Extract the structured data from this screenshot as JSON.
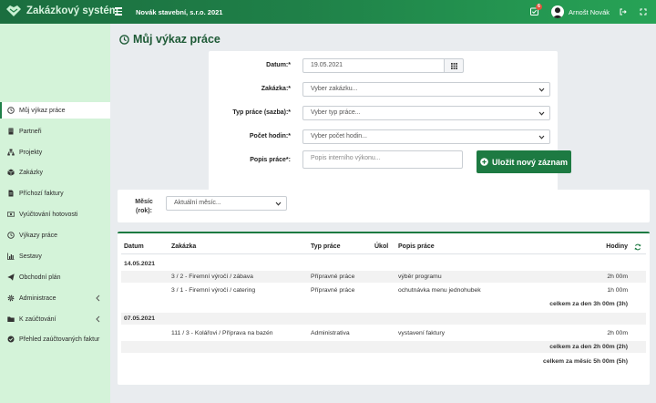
{
  "app": {
    "title": "Zakázkový systém",
    "company": "Novák stavební, s.r.o. 2021",
    "user": "Arnošt Novák",
    "task_badge": "6"
  },
  "sidebar": {
    "items": [
      {
        "label": "Můj výkaz práce",
        "icon": "clock-icon",
        "active": true
      },
      {
        "label": "Partneři",
        "icon": "building-icon"
      },
      {
        "label": "Projekty",
        "icon": "sitemap-icon"
      },
      {
        "label": "Zakázky",
        "icon": "box-icon"
      },
      {
        "label": "Příchozí faktury",
        "icon": "document-icon"
      },
      {
        "label": "Vyúčtování hotovosti",
        "icon": "money-icon"
      },
      {
        "label": "Výkazy práce",
        "icon": "clock-icon"
      },
      {
        "label": "Sestavy",
        "icon": "bar-chart-icon"
      },
      {
        "label": "Obchodní plán",
        "icon": "paper-plane-icon"
      },
      {
        "label": "Administrace",
        "icon": "gear-icon",
        "submenu": true
      },
      {
        "label": "K zaúčtování",
        "icon": "folder-icon",
        "submenu": true
      },
      {
        "label": "Přehled zaúčtovaných faktur",
        "icon": "check-circle-icon"
      }
    ]
  },
  "page": {
    "title": "Můj výkaz práce"
  },
  "form": {
    "date_label": "Datum:*",
    "date_value": "19.05.2021",
    "order_label": "Zakázka:*",
    "order_placeholder": "Vyber zakázku...",
    "worktype_label": "Typ práce (sazba):*",
    "worktype_placeholder": "Vyber typ práce...",
    "hours_label": "Počet hodin:*",
    "hours_placeholder": "Vyber počet hodin...",
    "desc_label": "Popis práce*:",
    "desc_placeholder": "Popis interního výkonu...",
    "save_label": "Uložit nový záznam"
  },
  "filter": {
    "month_label_line1": "Měsíc",
    "month_label_line2": "(rok):",
    "month_value": "Aktuální měsíc..."
  },
  "table": {
    "headers": {
      "date": "Datum",
      "order": "Zakázka",
      "type": "Typ práce",
      "task": "Úkol",
      "desc": "Popis práce",
      "hours": "Hodiny"
    },
    "groups": [
      {
        "date": "14.05.2021",
        "rows": [
          {
            "order": "3 / 2 - Firemní výročí / zábava",
            "type": "Přípravné práce",
            "desc": "výběr programu",
            "hours": "2h 00m"
          },
          {
            "order": "3 / 1 - Firemní výročí / catering",
            "type": "Přípravné práce",
            "desc": "ochutnávka menu jednohubek",
            "hours": "1h 00m"
          }
        ],
        "total": "celkem za den 3h 00m (3h)"
      },
      {
        "date": "07.05.2021",
        "rows": [
          {
            "order": "111 / 3 - Kolářovi / Příprava na bazén",
            "type": "Administrativa",
            "desc": "vystavení faktury",
            "hours": "2h 00m"
          }
        ],
        "total": "celkem za den 2h 00m (2h)"
      }
    ],
    "month_total": "celkem za měsíc 5h 00m (5h)"
  },
  "colors": {
    "brand_dark": "#1b6e3f",
    "brand_light": "#27a356",
    "sidebar_bg": "#d4f3d9",
    "save_button": "#1d7a42"
  }
}
